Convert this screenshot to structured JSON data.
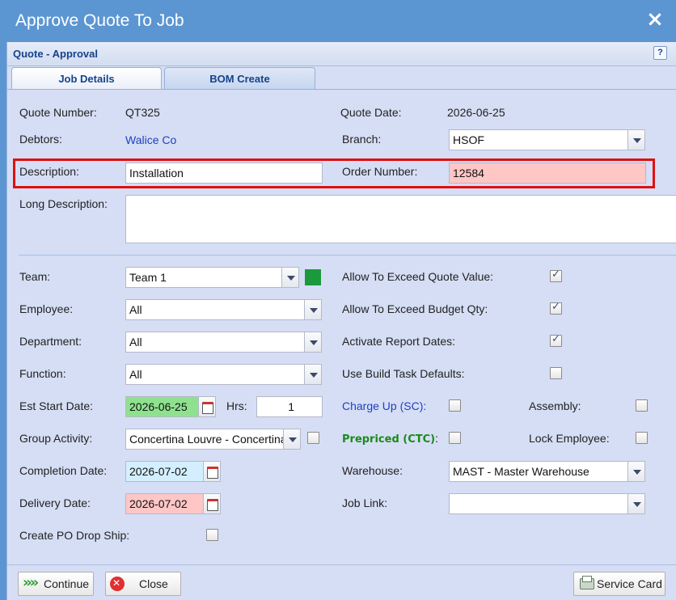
{
  "window": {
    "title": "Approve Quote To Job",
    "close_glyph": "×"
  },
  "panel": {
    "title": "Quote - Approval",
    "help_glyph": "?"
  },
  "tabs": [
    {
      "label": "Job Details",
      "active": true
    },
    {
      "label": "BOM Create",
      "active": false
    }
  ],
  "form": {
    "quote_number_label": "Quote Number:",
    "quote_number": "QT325",
    "quote_date_label": "Quote Date:",
    "quote_date": "2026-06-25",
    "debtors_label": "Debtors:",
    "debtors": "Walice Co",
    "branch_label": "Branch:",
    "branch": "HSOF",
    "description_label": "Description:",
    "description": "Installation",
    "order_number_label": "Order Number:",
    "order_number": "12584",
    "long_description_label": "Long Description:",
    "long_description": "",
    "team_label": "Team:",
    "team": "Team 1",
    "team_color": "#1a9a3c",
    "employee_label": "Employee:",
    "employee": "All",
    "department_label": "Department:",
    "department": "All",
    "function_label": "Function:",
    "function": "All",
    "est_start_date_label": "Est Start Date:",
    "est_start_date": "2026-06-25",
    "hrs_label": "Hrs:",
    "hrs": "1",
    "group_activity_label": "Group Activity:",
    "group_activity": "Concertina Louvre - Concertina",
    "completion_date_label": "Completion Date:",
    "completion_date": "2026-07-02",
    "delivery_date_label": "Delivery Date:",
    "delivery_date": "2026-07-02",
    "create_po_label": "Create PO Drop Ship:",
    "allow_exceed_quote_label": "Allow To Exceed Quote Value:",
    "allow_exceed_budget_label": "Allow To Exceed Budget Qty:",
    "activate_report_dates_label": "Activate Report Dates:",
    "use_build_task_label": "Use Build Task Defaults:",
    "charge_up_label": "Charge Up (SC):",
    "assembly_label": "Assembly:",
    "prepriced_label": "Prepriced (CTC)",
    "prepriced_colon": ":",
    "lock_employee_label": "Lock Employee:",
    "warehouse_label": "Warehouse:",
    "warehouse": "MAST - Master Warehouse",
    "job_link_label": "Job Link:",
    "job_link": ""
  },
  "checks": {
    "allow_exceed_quote": true,
    "allow_exceed_budget": true,
    "activate_report_dates": true,
    "use_build_task": false,
    "charge_up": false,
    "assembly": false,
    "prepriced": false,
    "lock_employee": false,
    "group_activity": false,
    "create_po": false
  },
  "footer": {
    "continue_label": "Continue",
    "close_label": "Close",
    "service_card_label": "Service Card"
  }
}
